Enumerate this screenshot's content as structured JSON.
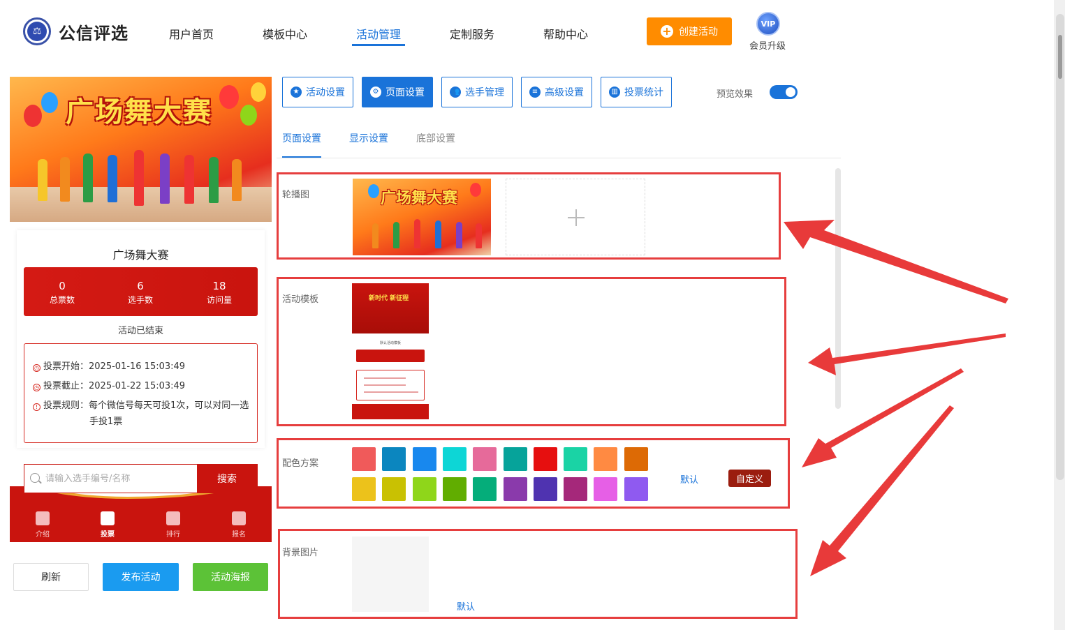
{
  "header": {
    "logo_text": "公信评选",
    "logo_icon": "scales-icon",
    "nav": [
      "用户首页",
      "模板中心",
      "活动管理",
      "定制服务",
      "帮助中心"
    ],
    "active_nav": "活动管理",
    "create_label": "创建活动",
    "vip_badge": "VIP",
    "vip_label": "会员升级"
  },
  "preview": {
    "banner_title": "广场舞大赛",
    "card_title": "广场舞大赛",
    "stats": [
      {
        "num": "0",
        "label": "总票数"
      },
      {
        "num": "6",
        "label": "选手数"
      },
      {
        "num": "18",
        "label": "访问量"
      }
    ],
    "status": "活动已结束",
    "rules": {
      "start": "投票开始：2025-01-16 15:03:49",
      "end": "投票截止：2025-01-22 15:03:49",
      "rule_line1": "投票规则：每个微信号每天可投1次，可以对同一选",
      "rule_line2": "手投1票"
    },
    "search_placeholder": "请输入选手编号/名称",
    "search_button": "搜索",
    "bottom_nav": [
      {
        "label": "介绍",
        "icon": "book-icon"
      },
      {
        "label": "投票",
        "icon": "home-icon"
      },
      {
        "label": "排行",
        "icon": "trophy-icon"
      },
      {
        "label": "报名",
        "icon": "edit-icon"
      }
    ],
    "active_bottom": "投票",
    "buttons": {
      "refresh": "刷新",
      "publish": "发布活动",
      "poster": "活动海报"
    }
  },
  "tabs": [
    {
      "label": "活动设置",
      "icon": "star-icon"
    },
    {
      "label": "页面设置",
      "icon": "gear-icon"
    },
    {
      "label": "选手管理",
      "icon": "users-icon"
    },
    {
      "label": "高级设置",
      "icon": "sliders-icon"
    },
    {
      "label": "投票统计",
      "icon": "bar-chart-icon"
    }
  ],
  "active_tab": "页面设置",
  "preview_toggle": {
    "label": "预览效果",
    "on": true
  },
  "sub_tabs": [
    "页面设置",
    "显示设置",
    "底部设置"
  ],
  "active_sub_tab": "页面设置",
  "sections": {
    "carousel": {
      "label": "轮播图",
      "image_title": "广场舞大赛"
    },
    "template": {
      "label": "活动模板",
      "thumb_title": "新时代 新征程",
      "thumb_caption": "默认活动模板"
    },
    "colors": {
      "label": "配色方案",
      "row1": [
        "#f05a5a",
        "#0b86bf",
        "#1888ee",
        "#0dd6d6",
        "#e66a9a",
        "#06a39a",
        "#e60f0f",
        "#1ad3a5",
        "#ff8a42",
        "#dd6a05"
      ],
      "row2": [
        "#ecc21b",
        "#c9c102",
        "#8fd61a",
        "#61ad00",
        "#05ad7a",
        "#8a3aab",
        "#4f33b0",
        "#a5287a",
        "#e65fe6",
        "#8f5af0"
      ],
      "default_label": "默认",
      "custom_label": "自定义"
    },
    "background": {
      "label": "背景图片",
      "default_label": "默认"
    }
  }
}
